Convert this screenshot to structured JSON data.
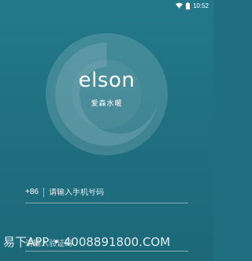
{
  "status_bar": {
    "time": "10:52",
    "icons": [
      "wifi-icon",
      "battery-icon"
    ]
  },
  "logo": {
    "brand_name": "elson",
    "brand_sub": "爱森水暖"
  },
  "login": {
    "country_code": "+86",
    "phone_placeholder": "请输入手机号码",
    "code_placeholder": "请输入验证码"
  },
  "watermark": {
    "text": "易下APP • 4008891800.COM"
  },
  "colors": {
    "background": "#1f6f80",
    "text": "#ffffff"
  }
}
